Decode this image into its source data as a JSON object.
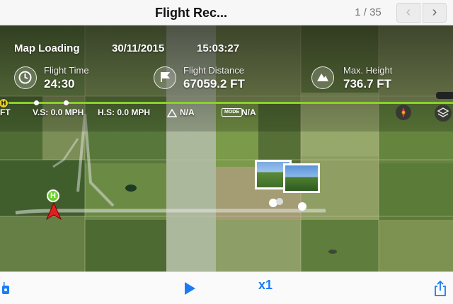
{
  "header": {
    "title": "Flight Rec...",
    "pager": "1 / 35",
    "prev_icon": "‹",
    "next_icon": "›"
  },
  "overlay": {
    "status": "Map Loading",
    "date": "30/11/2015",
    "time": "15:03:27",
    "flight_time_label": "Flight Time",
    "flight_time_value": "24:30",
    "distance_label": "Flight Distance",
    "distance_value": "67059.2 FT",
    "height_label": "Max. Height",
    "height_value": "736.7 FT",
    "left_unit": "FT",
    "vs": "V.S: 0.0 MPH",
    "hs": "H.S: 0.0 MPH",
    "attitude_value": "N/A",
    "mode_badge": "MODE",
    "mode_value": "N/A",
    "home_label": "H",
    "timeline_color": "#8bd12a"
  },
  "footer": {
    "speed": "x1"
  }
}
